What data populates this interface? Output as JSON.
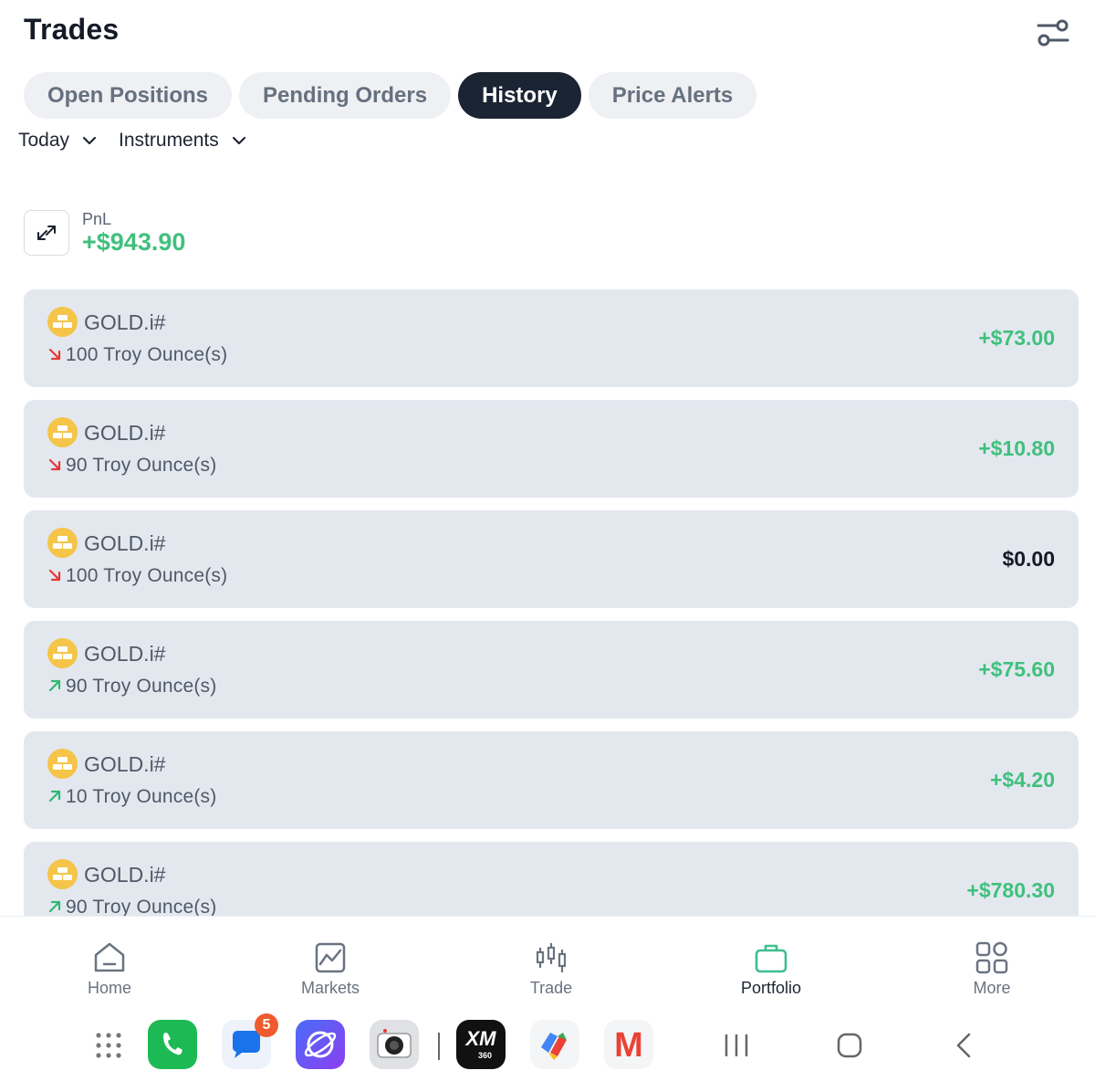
{
  "header": {
    "title": "Trades",
    "settings_icon": "sliders-icon"
  },
  "tabs": [
    {
      "label": "Open Positions",
      "active": false
    },
    {
      "label": "Pending Orders",
      "active": false
    },
    {
      "label": "History",
      "active": true
    },
    {
      "label": "Price Alerts",
      "active": false
    }
  ],
  "filters": {
    "period": "Today",
    "instruments": "Instruments"
  },
  "pnl": {
    "label": "PnL",
    "value": "+$943.90"
  },
  "trades": [
    {
      "symbol": "GOLD.i#",
      "direction": "sell",
      "quantity": "100 Troy Ounce(s)",
      "pnl": "+$73.00"
    },
    {
      "symbol": "GOLD.i#",
      "direction": "sell",
      "quantity": "90 Troy Ounce(s)",
      "pnl": "+$10.80"
    },
    {
      "symbol": "GOLD.i#",
      "direction": "sell",
      "quantity": "100 Troy Ounce(s)",
      "pnl": "$0.00"
    },
    {
      "symbol": "GOLD.i#",
      "direction": "buy",
      "quantity": "90 Troy Ounce(s)",
      "pnl": "+$75.60"
    },
    {
      "symbol": "GOLD.i#",
      "direction": "buy",
      "quantity": "10 Troy Ounce(s)",
      "pnl": "+$4.20"
    },
    {
      "symbol": "GOLD.i#",
      "direction": "buy",
      "quantity": "90 Troy Ounce(s)",
      "pnl": "+$780.30"
    }
  ],
  "bottom_nav": [
    {
      "label": "Home",
      "icon": "home-icon",
      "active": false
    },
    {
      "label": "Markets",
      "icon": "chart-icon",
      "active": false
    },
    {
      "label": "Trade",
      "icon": "candlestick-icon",
      "active": false
    },
    {
      "label": "Portfolio",
      "icon": "briefcase-icon",
      "active": true
    },
    {
      "label": "More",
      "icon": "grid-icon",
      "active": false
    }
  ],
  "system_bar": {
    "messages_badge": "5",
    "xm_label": "XM",
    "xm_sublabel": "360",
    "gmail_label": "M"
  },
  "colors": {
    "positive": "#40c07d",
    "negative": "#e53935",
    "accent": "#3fbf8f",
    "dark": "#1b2433"
  }
}
